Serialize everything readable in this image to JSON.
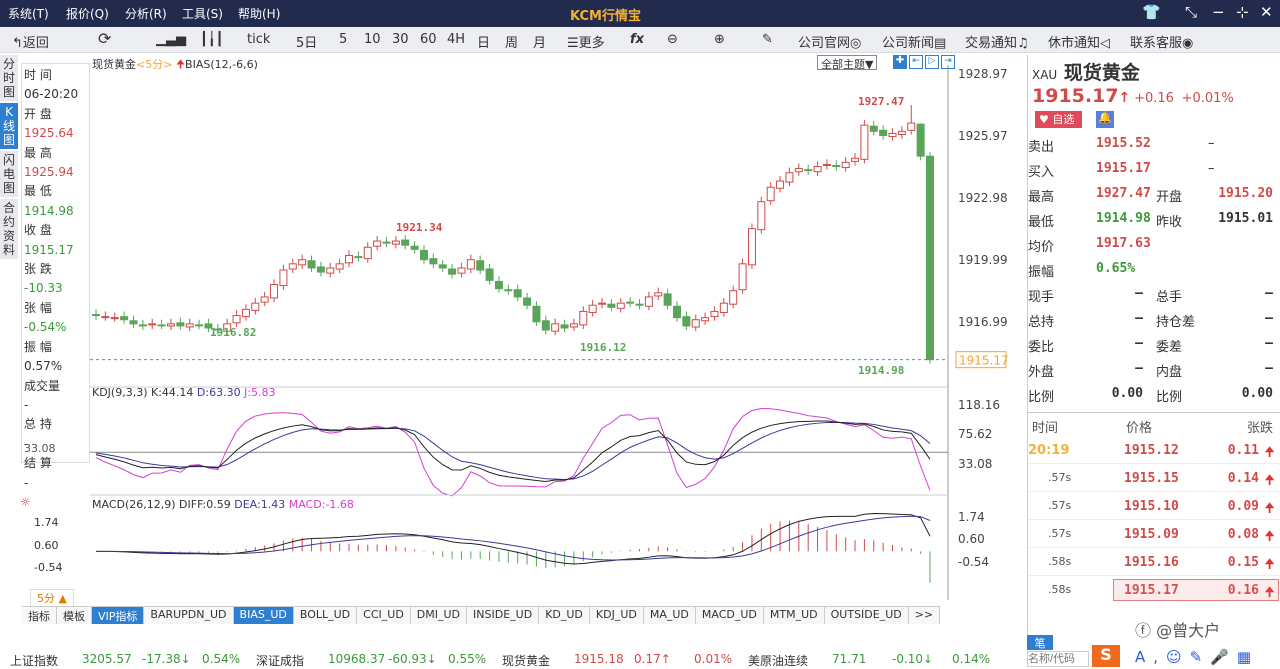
{
  "titlebar": {
    "menus": [
      "系统(T)",
      "报价(Q)",
      "分析(R)",
      "工具(S)",
      "帮助(H)"
    ],
    "app_title": "KCM行情宝"
  },
  "toolbar": {
    "back": "返回",
    "periods": [
      "tick",
      "5日",
      "5",
      "10",
      "30",
      "60",
      "4H",
      "日",
      "周",
      "月"
    ],
    "more": "更多",
    "links": [
      "公司官网",
      "公司新闻",
      "交易通知",
      "休市通知",
      "联系客服"
    ]
  },
  "vtabs": [
    "分时图",
    "K线图",
    "闪电图",
    "合约资料"
  ],
  "info": [
    [
      "时 间",
      "06-20:20",
      "gray"
    ],
    [
      "开 盘",
      "1925.64",
      "red"
    ],
    [
      "最 高",
      "1925.94",
      "red"
    ],
    [
      "最 低",
      "1914.98",
      "green"
    ],
    [
      "收 盘",
      "1915.17",
      "green"
    ],
    [
      "张 跌",
      "-10.33",
      "green"
    ],
    [
      "张 幅",
      "-0.54%",
      "green"
    ],
    [
      "振 幅",
      "0.57%",
      "gray"
    ],
    [
      "成交量",
      "-",
      "gray"
    ],
    [
      "总 持",
      "-",
      "gray"
    ],
    [
      "结 算",
      "-",
      "gray"
    ]
  ],
  "chart_header": {
    "symbol": "现货黄金",
    "period": "<5分>",
    "indicator": "BIAS(12,-6,6)",
    "theme_select": "全部主题▼"
  },
  "price_axis": {
    "ticks": [
      1928.97,
      1925.97,
      1922.98,
      1919.99,
      1916.99
    ],
    "current": "1915.17"
  },
  "annotations": {
    "high": "1927.47",
    "mid_high": "1921.34",
    "low1": "1916.82",
    "low2": "1916.12",
    "last_low": "1914.98"
  },
  "closes": [
    1917.3,
    1917.25,
    1917.2,
    1917.1,
    1916.9,
    1916.8,
    1916.9,
    1916.85,
    1916.9,
    1916.8,
    1916.9,
    1916.85,
    1916.7,
    1916.6,
    1916.9,
    1917.3,
    1917.6,
    1917.9,
    1918.2,
    1918.8,
    1919.5,
    1919.8,
    1920.0,
    1919.6,
    1919.4,
    1919.6,
    1919.8,
    1920.2,
    1920.1,
    1920.6,
    1920.9,
    1920.8,
    1920.9,
    1920.7,
    1920.5,
    1920.0,
    1919.8,
    1919.6,
    1919.3,
    1919.6,
    1920.0,
    1919.5,
    1919.0,
    1918.6,
    1918.5,
    1918.2,
    1917.8,
    1917.0,
    1916.6,
    1916.9,
    1916.7,
    1916.9,
    1917.5,
    1917.8,
    1917.9,
    1917.7,
    1917.9,
    1917.9,
    1917.8,
    1918.2,
    1918.4,
    1917.8,
    1917.2,
    1916.8,
    1917.1,
    1917.2,
    1917.5,
    1917.9,
    1918.5,
    1919.8,
    1921.5,
    1922.8,
    1923.5,
    1923.8,
    1924.2,
    1924.4,
    1924.3,
    1924.5,
    1924.6,
    1924.5,
    1924.7,
    1924.9,
    1926.5,
    1926.2,
    1926.0,
    1926.1,
    1926.2,
    1926.6,
    1925.0,
    1915.17
  ],
  "kdj": {
    "label": "KDJ(9,3,3)",
    "k": "K:44.14",
    "d": "D:63.30",
    "j": "J:5.83",
    "ticks": [
      "118.16",
      "75.62",
      "33.08"
    ],
    "left_tick": "33.08"
  },
  "macd": {
    "label": "MACD(26,12,9)",
    "diff": "DIFF:0.59",
    "dea": "DEA:1.43",
    "macd": "MACD:-1.68",
    "ticks": [
      "1.74",
      "0.60",
      "-0.54"
    ]
  },
  "period_button": "5分 ▲",
  "bottom_tabs": [
    "指标",
    "模板",
    "VIP指标",
    "BARUPDN_UD",
    "BIAS_UD",
    "BOLL_UD",
    "CCI_UD",
    "DMI_UD",
    "INSIDE_UD",
    "KD_UD",
    "KDJ_UD",
    "MA_UD",
    "MACD_UD",
    "MTM_UD",
    "OUTSIDE_UD",
    ">>"
  ],
  "quote": {
    "code": "XAU",
    "name": "现货黄金",
    "price": "1915.17",
    "change": "+0.16",
    "pct": "+0.01%",
    "fav": "自选",
    "bidask": [
      [
        "卖出",
        "1915.52",
        "–"
      ],
      [
        "买入",
        "1915.17",
        "–"
      ]
    ],
    "stats": [
      [
        "最高",
        "1927.47",
        "red",
        "开盘",
        "1915.20",
        "red"
      ],
      [
        "最低",
        "1914.98",
        "green",
        "昨收",
        "1915.01",
        "gray"
      ],
      [
        "均价",
        "1917.63",
        "red",
        "",
        "",
        " "
      ],
      [
        "振幅",
        "0.65%",
        "green",
        "",
        "",
        " "
      ]
    ],
    "vol": [
      [
        "现手",
        "–",
        "总手",
        "–"
      ],
      [
        "总持",
        "–",
        "持仓差",
        "–"
      ],
      [
        "委比",
        "–",
        "委差",
        "–"
      ],
      [
        "外盘",
        "–",
        "内盘",
        "–"
      ],
      [
        "比例",
        "0.00",
        "比例",
        "0.00"
      ]
    ]
  },
  "ticks": {
    "headers": [
      "时间",
      "价格",
      "张跌"
    ],
    "rows": [
      [
        "20:19",
        "1915.12",
        "0.11"
      ],
      [
        ".57s",
        "1915.15",
        "0.14"
      ],
      [
        ".57s",
        "1915.10",
        "0.09"
      ],
      [
        ".57s",
        "1915.09",
        "0.08"
      ],
      [
        ".58s",
        "1915.16",
        "0.15"
      ],
      [
        ".58s",
        "1915.17",
        "0.16"
      ]
    ]
  },
  "ime_label": "笔",
  "search_placeholder": "名称/代码",
  "watermark": "@曾大户",
  "status": [
    [
      "上证指数",
      "3205.57",
      "-17.38↓",
      "0.54%",
      "green"
    ],
    [
      "深证成指",
      "10968.37",
      "-60.93↓",
      "0.55%",
      "green"
    ],
    [
      "现货黄金",
      "1915.18",
      "0.17↑",
      "0.01%",
      "red"
    ],
    [
      "美原油连续",
      "71.71",
      "-0.10↓",
      "0.14%",
      "green"
    ]
  ],
  "colors": {
    "up": "#d04a4a",
    "down": "#5aa55a",
    "accent": "#2f7fd0",
    "title_bg": "#222b4e"
  }
}
